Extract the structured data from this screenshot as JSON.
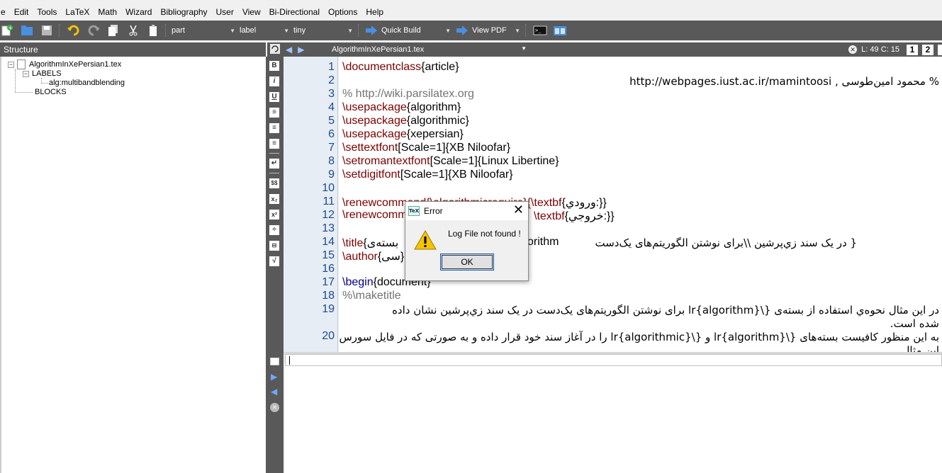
{
  "menubar": {
    "items": [
      "e",
      "Edit",
      "Tools",
      "LaTeX",
      "Math",
      "Wizard",
      "Bibliography",
      "User",
      "View",
      "Bi-Directional",
      "Options",
      "Help"
    ]
  },
  "toolbar": {
    "sectioning_combo": "part",
    "ref_combo": "label",
    "size_combo": "tiny",
    "quick_build": "Quick Build",
    "view_pdf": "View PDF"
  },
  "structure": {
    "header": "Structure",
    "file": "AlgorithmInXePersian1.tex",
    "labels_node": "LABELS",
    "label_item": "alg:multibandblending",
    "blocks_node": "BLOCKS"
  },
  "editor": {
    "tab_title": "AlgorithmInXePersian1.tex",
    "cursor_pos": "L: 49 C: 15",
    "bookmark1": "1",
    "bookmark2": "2",
    "line_numbers": [
      "1",
      "2",
      "3",
      "4",
      "5",
      "6",
      "7",
      "8",
      "9",
      "10",
      "11",
      "12",
      "13",
      "14",
      "15",
      "16",
      "17",
      "18",
      "19",
      "20"
    ],
    "lines": {
      "l1_cmd": "\\documentclass",
      "l1_arg": "{article}",
      "l2_rtl": "% محمود امین‌طوسی , http://webpages.iust.ac.ir/mamintoosi",
      "l3": "% http://wiki.parsilatex.org",
      "l4_cmd": "\\usepackage",
      "l4_arg": "{algorithm}",
      "l5_cmd": "\\usepackage",
      "l5_arg": "{algorithmic}",
      "l6_cmd": "\\usepackage",
      "l6_arg": "{xepersian}",
      "l7_cmd": "\\settextfont",
      "l7_arg": "[Scale=1]{XB Niloofar}",
      "l8_cmd": "\\setromantextfont",
      "l8_arg": "[Scale=1]{Linux Libertine}",
      "l9_cmd": "\\setdigitfont",
      "l9_arg": "[Scale=1]{XB Niloofar}",
      "l11_cmd": "\\renewcommand",
      "l11_arg": "{\\algorithmicrequire}{",
      "l11_cmd2": "\\textbf",
      "l11_arg2": "{ورودي:}}",
      "l12_cmd": "\\renewcomm",
      "l12_cmd2": "\\textbf",
      "l12_arg2": "{خروجي:}}",
      "l14_cmd": "\\title",
      "l14_arg": "{بسته‌ی",
      "l14_mid": "orithm",
      "l14_rtl": "{ در یک سند زي‌پرشین \\\\برای نوشتن الگوریتم‌های یک‌دست",
      "l15_cmd": "\\author",
      "l15_arg": "{سی}",
      "l17_cmd": "\\begin",
      "l17_arg": "{document}",
      "l18": "%\\maketitle",
      "l19_rtl": "در این مثال نحوه‌ي استفاده از بسته‌ی {\\lr{algorithm} برای نوشتن الگوریتم‌های یک‌دست در یک سند زي‌پرشین نشان داده",
      "l19b_rtl": "شده است.",
      "l20_rtl": "به این منظور کافیست بسته‌های {\\lr{algorithm} و {\\lr{algorithmic} را در آغاز سند خود قرار داده و به صورتی که در فایل سورس",
      "l20b_rtl": "این مثال"
    }
  },
  "dialog": {
    "title": "Error",
    "message": "Log File not found !",
    "ok_label": "OK",
    "app_icon_text": "TeX"
  },
  "colors": {
    "toolbar_bg": "#595959",
    "command_color": "#7b0000",
    "comment_color": "#737373",
    "line_number_color": "#1d4b8e"
  }
}
